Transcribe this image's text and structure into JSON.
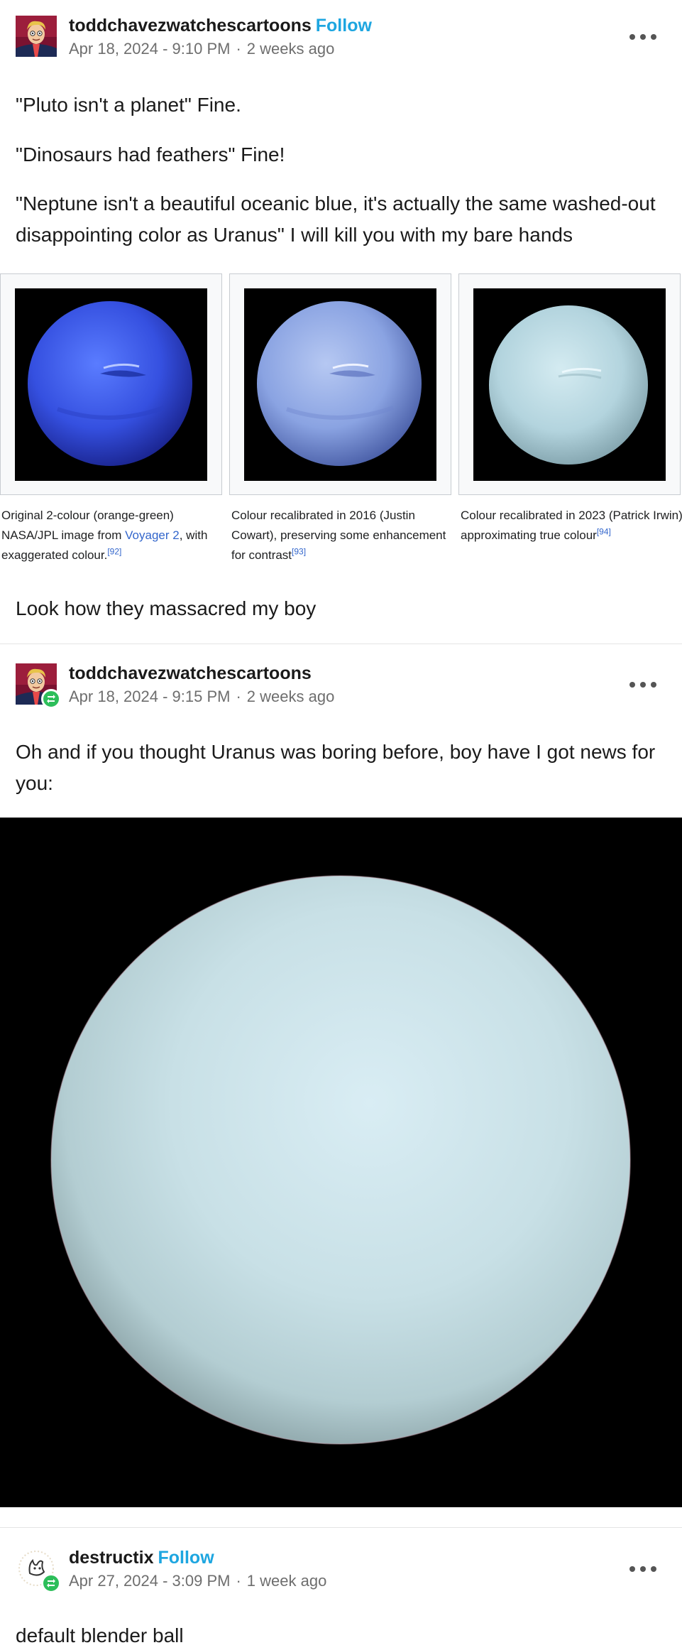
{
  "posts": [
    {
      "author": "toddchavezwatchescartoons",
      "follow_label": "Follow",
      "date": "Apr 18, 2024 - 9:10 PM",
      "relative": "2 weeks ago",
      "paragraphs": [
        "\"Pluto isn't a planet\" Fine.",
        "\"Dinosaurs had feathers\" Fine!",
        "\"Neptune isn't a beautiful oceanic blue, it's actually the same washed-out disappointing color as Uranus\" I will kill you with my bare hands"
      ],
      "wiki_captions": [
        {
          "pre": "Original 2-colour (orange-green) NASA/JPL image from ",
          "link": "Voyager 2",
          "post": ", with exaggerated colour.",
          "ref": "[92]"
        },
        {
          "pre": "Colour recalibrated in 2016 (Justin Cowart), preserving some enhancement for contrast",
          "link": "",
          "post": "",
          "ref": "[93]"
        },
        {
          "pre": "Colour recalibrated in 2023 (Patrick Irwin), approximating true colour",
          "link": "",
          "post": "",
          "ref": "[94]"
        }
      ],
      "closing": "Look how they massacred my boy"
    },
    {
      "author": "toddchavezwatchescartoons",
      "date": "Apr 18, 2024 - 9:15 PM",
      "relative": "2 weeks ago",
      "text": "Oh and if you thought Uranus was boring before, boy have I got news for you:"
    },
    {
      "author": "destructix",
      "follow_label": "Follow",
      "date": "Apr 27, 2024 - 3:09 PM",
      "relative": "1 week ago",
      "text": "default blender ball"
    }
  ],
  "separator": "·",
  "icons": {
    "menu": "more-options-icon",
    "reblog": "reblog-icon"
  },
  "colors": {
    "follow": "#1ea6e0",
    "reblog_badge": "#2dbe5a",
    "neptune_original": "#3d5fe0",
    "neptune_2016": "#8fa8e6",
    "neptune_2023": "#b7d8e2",
    "uranus": "#cfe5ec"
  }
}
